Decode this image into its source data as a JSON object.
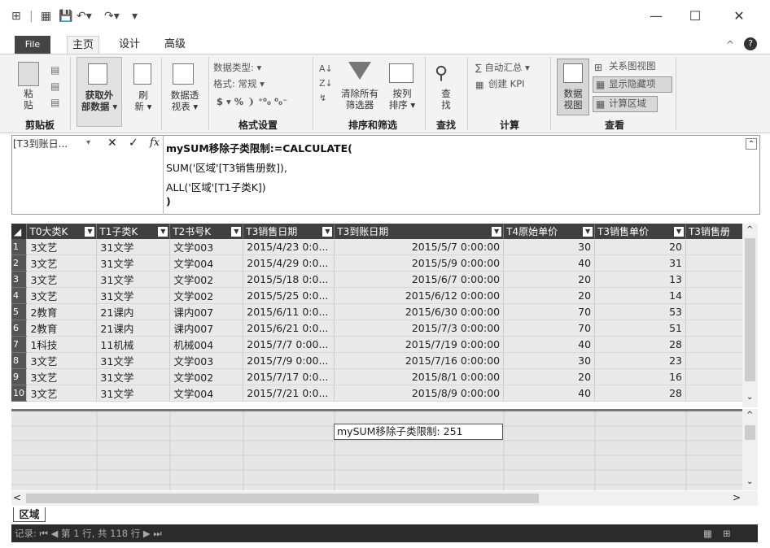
{
  "quick_access": {
    "window_controls": {
      "minimize": "—",
      "maximize": "☐",
      "close": "✕"
    }
  },
  "tabs": [
    {
      "label": "File"
    },
    {
      "label": "主页"
    },
    {
      "label": "设计"
    },
    {
      "label": "高级"
    }
  ],
  "ribbon": {
    "clipboard": {
      "paste": "粘\n贴",
      "group": "剪贴板"
    },
    "get_data": {
      "label": "获取外\n部数据 ▾",
      "refresh": "刷\n新 ▾"
    },
    "pivot": {
      "label": "数据透\n视表 ▾"
    },
    "format": {
      "data_type": "数据类型: ▾",
      "format": "格式: 常规 ▾",
      "symbols": "$ ▾ % ❩ ⁺⁰₀ ⁰₀⁻",
      "group": "格式设置"
    },
    "sort": {
      "clear_filters": "清除所有\n筛选器",
      "sort_col": "按列\n排序 ▾",
      "group": "排序和筛选"
    },
    "find": {
      "label": "查\n找",
      "group": "查找"
    },
    "calc": {
      "autosum": "∑ 自动汇总 ▾",
      "kpi": "创建 KPI",
      "group": "计算"
    },
    "view": {
      "data_view": "数据\n视图",
      "diagram": "关系图视图",
      "show_hidden": "显示隐藏项",
      "calc_area": "计算区域",
      "group": "查看"
    }
  },
  "formula": {
    "name_box": "[T3到账日...",
    "name_box_arrow": "▾",
    "cancel": "✕",
    "confirm": "✓",
    "fx": "fx",
    "lines": [
      "mySUM移除子类限制:=CALCULATE(",
      "SUM('区域'[T3销售册数]),",
      "ALL('区域'[T1子类K])",
      ")"
    ],
    "collapse": "⌃"
  },
  "table": {
    "columns": [
      "T0大类K",
      "T1子类K",
      "T2书号K",
      "T3销售日期",
      "T3到账日期",
      "T4原始单价",
      "T3销售单价",
      "T3销售册"
    ],
    "rows": [
      [
        "1",
        "3文艺",
        "31文学",
        "文学003",
        "2015/4/23 0:0...",
        "2015/5/7 0:00:00",
        "30",
        "20"
      ],
      [
        "2",
        "3文艺",
        "31文学",
        "文学004",
        "2015/4/29 0:0...",
        "2015/5/9 0:00:00",
        "40",
        "31"
      ],
      [
        "3",
        "3文艺",
        "31文学",
        "文学002",
        "2015/5/18 0:0...",
        "2015/6/7 0:00:00",
        "20",
        "13"
      ],
      [
        "4",
        "3文艺",
        "31文学",
        "文学002",
        "2015/5/25 0:0...",
        "2015/6/12 0:00:00",
        "20",
        "14"
      ],
      [
        "5",
        "2教育",
        "21课内",
        "课内007",
        "2015/6/11 0:0...",
        "2015/6/30 0:00:00",
        "70",
        "53"
      ],
      [
        "6",
        "2教育",
        "21课内",
        "课内007",
        "2015/6/21 0:0...",
        "2015/7/3 0:00:00",
        "70",
        "51"
      ],
      [
        "7",
        "1科技",
        "11机械",
        "机械004",
        "2015/7/7 0:00...",
        "2015/7/19 0:00:00",
        "40",
        "28"
      ],
      [
        "8",
        "3文艺",
        "31文学",
        "文学003",
        "2015/7/9 0:00...",
        "2015/7/16 0:00:00",
        "30",
        "23"
      ],
      [
        "9",
        "3文艺",
        "31文学",
        "文学002",
        "2015/7/17 0:0...",
        "2015/8/1 0:00:00",
        "20",
        "16"
      ],
      [
        "10",
        "3文艺",
        "31文学",
        "文学004",
        "2015/7/21 0:0...",
        "2015/8/9 0:00:00",
        "40",
        "28"
      ]
    ]
  },
  "measure": {
    "text": "mySUM移除子类限制: 251"
  },
  "sheet_tab": "区域",
  "status": {
    "text": "记录: ⏮ ◀  第 1 行, 共 118 行  ▶ ⏭"
  }
}
